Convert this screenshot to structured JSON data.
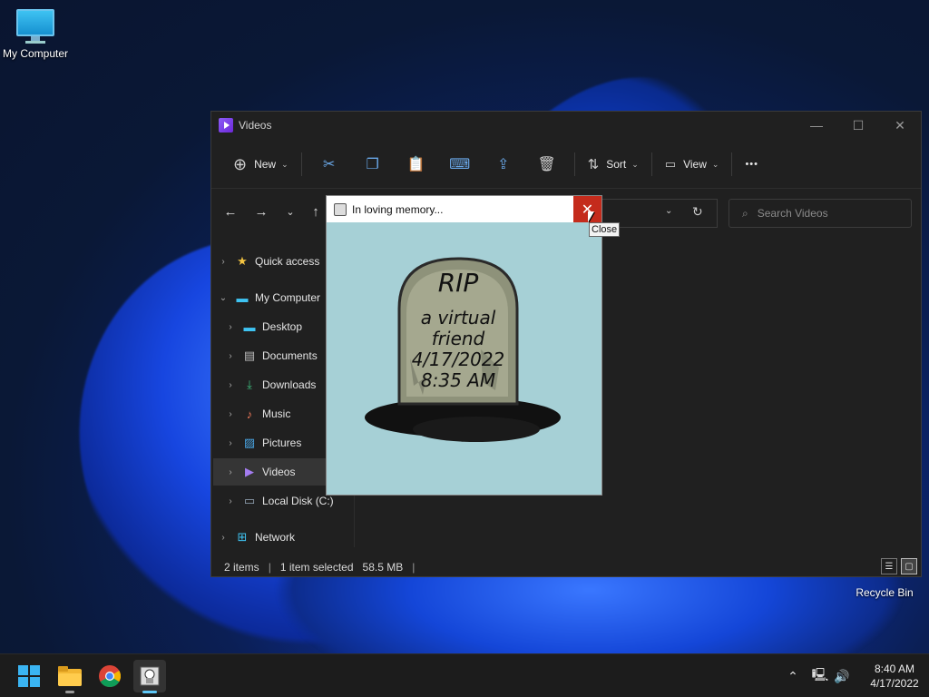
{
  "desktop": {
    "icons": [
      {
        "label": "My Computer"
      },
      {
        "label": "Recycle Bin"
      }
    ]
  },
  "explorer": {
    "title": "Videos",
    "toolbar": {
      "new_label": "New",
      "sort_label": "Sort",
      "view_label": "View",
      "more_label": "•••"
    },
    "search": {
      "placeholder": "Search Videos"
    },
    "sidebar": {
      "items": [
        {
          "label": "Quick access",
          "icon": "star-icon"
        },
        {
          "label": "My Computer",
          "icon": "monitor-icon"
        },
        {
          "label": "Desktop",
          "icon": "desktop-folder-icon"
        },
        {
          "label": "Documents",
          "icon": "documents-icon"
        },
        {
          "label": "Downloads",
          "icon": "download-icon"
        },
        {
          "label": "Music",
          "icon": "music-icon"
        },
        {
          "label": "Pictures",
          "icon": "pictures-icon"
        },
        {
          "label": "Videos",
          "icon": "videos-icon"
        },
        {
          "label": "Local Disk (C:)",
          "icon": "drive-icon"
        },
        {
          "label": "Network",
          "icon": "network-icon"
        }
      ]
    },
    "status": {
      "items": "2 items",
      "selected": "1 item selected",
      "size": "58.5 MB"
    }
  },
  "popup": {
    "title": "In loving memory...",
    "tooltip": "Close",
    "tombstone": {
      "line1": "RIP",
      "line2": "a virtual",
      "line3": "friend",
      "line4": "4/17/2022",
      "line5": "8:35 AM"
    }
  },
  "taskbar": {
    "time": "8:40 AM",
    "date": "4/17/2022"
  },
  "colors": {
    "close_red": "#c42b1c",
    "popup_bg": "#a6d0d6",
    "accent": "#5ec8f8"
  }
}
